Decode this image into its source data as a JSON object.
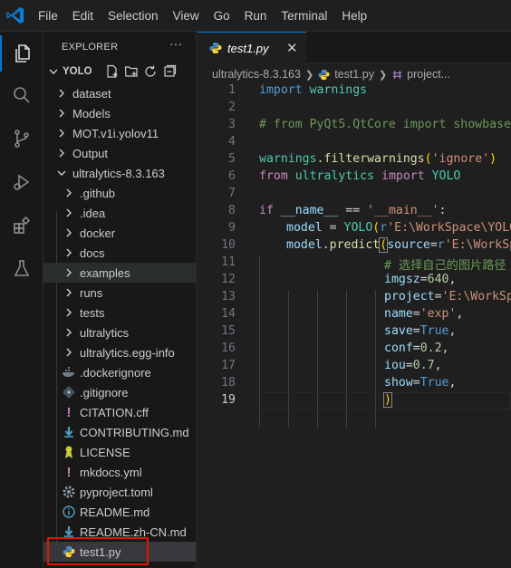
{
  "menu": [
    "File",
    "Edit",
    "Selection",
    "View",
    "Go",
    "Run",
    "Terminal",
    "Help"
  ],
  "explorer": {
    "title": "EXPLORER",
    "more": "···",
    "root": "YOLO",
    "items": [
      {
        "label": "dataset",
        "type": "folder"
      },
      {
        "label": "Models",
        "type": "folder"
      },
      {
        "label": "MOT.v1i.yolov11",
        "type": "folder"
      },
      {
        "label": "Output",
        "type": "folder"
      },
      {
        "label": "ultralytics-8.3.163",
        "type": "folder-open"
      },
      {
        "label": ".github",
        "type": "folder"
      },
      {
        "label": ".idea",
        "type": "folder"
      },
      {
        "label": "docker",
        "type": "folder"
      },
      {
        "label": "docs",
        "type": "folder"
      },
      {
        "label": "examples",
        "type": "folder"
      },
      {
        "label": "runs",
        "type": "folder"
      },
      {
        "label": "tests",
        "type": "folder"
      },
      {
        "label": "ultralytics",
        "type": "folder"
      },
      {
        "label": "ultralytics.egg-info",
        "type": "folder"
      },
      {
        "label": ".dockerignore",
        "type": "docker"
      },
      {
        "label": ".gitignore",
        "type": "git"
      },
      {
        "label": "CITATION.cff",
        "type": "exclaim"
      },
      {
        "label": "CONTRIBUTING.md",
        "type": "md"
      },
      {
        "label": "LICENSE",
        "type": "license"
      },
      {
        "label": "mkdocs.yml",
        "type": "exclaim"
      },
      {
        "label": "pyproject.toml",
        "type": "gear"
      },
      {
        "label": "README.md",
        "type": "info"
      },
      {
        "label": "README.zh-CN.md",
        "type": "md"
      },
      {
        "label": "test1.py",
        "type": "python"
      }
    ]
  },
  "tab": {
    "label": "test1.py",
    "close": "✕"
  },
  "breadcrumb": {
    "folder": "ultralytics-8.3.163",
    "file": "test1.py",
    "symbol": "project..."
  },
  "code": {
    "line_numbers": [
      "1",
      "2",
      "3",
      "4",
      "5",
      "6",
      "7",
      "8",
      "9",
      "10",
      "11",
      "12",
      "13",
      "14",
      "15",
      "16",
      "17",
      "18",
      "19"
    ],
    "l1": [
      "import",
      " ",
      "warnings"
    ],
    "l3": "# from PyQt5.QtCore import showbase",
    "l5": [
      "warnings",
      ".",
      "filterwarnings",
      "(",
      "'ignore'",
      ")"
    ],
    "l6": [
      "from",
      " ",
      "ultralytics",
      " ",
      "import",
      " ",
      "YOLO"
    ],
    "l8": [
      "if",
      " ",
      "__name__",
      " == ",
      "'__main__'",
      ":"
    ],
    "l9": [
      "model",
      " = ",
      "YOLO",
      "(",
      "r",
      "'E:\\WorkSpace\\YOLO"
    ],
    "l10": [
      "model",
      ".",
      "predict",
      "(",
      "source",
      "=",
      "r",
      "'E:\\WorkSp"
    ],
    "l11": "# 选择自己的图片路径",
    "l12": [
      "imgsz",
      "=",
      "640",
      ","
    ],
    "l13": [
      "project",
      "=",
      "'E:\\WorkSp"
    ],
    "l14": [
      "name",
      "=",
      "'exp'",
      ","
    ],
    "l15": [
      "save",
      "=",
      "True",
      ","
    ],
    "l16": [
      "conf",
      "=",
      "0.2",
      ","
    ],
    "l17": [
      "iou",
      "=",
      "0.7",
      ","
    ],
    "l18": [
      "show",
      "=",
      "True",
      ","
    ],
    "l19": [
      ")"
    ]
  },
  "colors": {
    "accent": "#0078d4",
    "highlight": "#e51400"
  }
}
